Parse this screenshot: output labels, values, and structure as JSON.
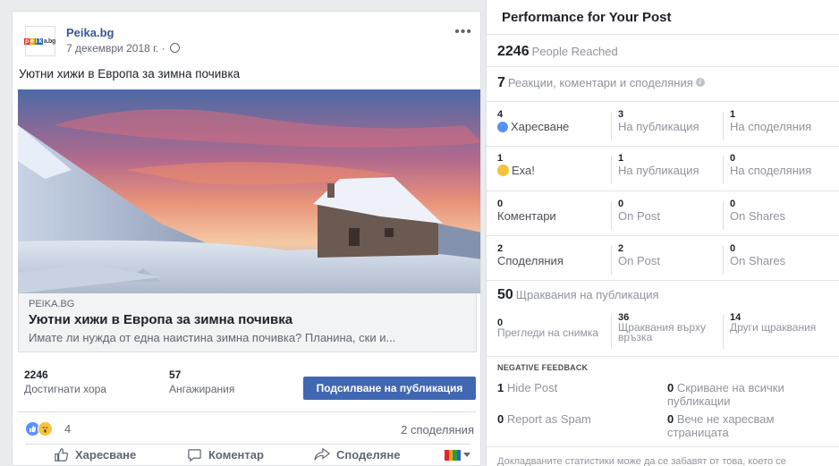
{
  "post": {
    "page_name": "Peika.bg",
    "logo_text": [
      "p",
      "e",
      "i",
      "k",
      "a.bg"
    ],
    "date": "7 декември 2018 г. ·",
    "menu_dots": "•••",
    "text": "Уютни хижи в Европа за зимна почивка",
    "link": {
      "domain": "PEIKA.BG",
      "title": "Уютни хижи в Европа за зимна почивка",
      "description": "Имате ли нужда от една наистина зимна почивка? Планина, ски и..."
    },
    "metrics": [
      {
        "value": "2246",
        "label": "Достигнати хора"
      },
      {
        "value": "57",
        "label": "Ангажирания"
      }
    ],
    "boost_label": "Подсилване на публикация",
    "reaction_count": "4",
    "shares_text": "2 споделяния",
    "actions": {
      "like": "Харесване",
      "comment": "Коментар",
      "share": "Споделяне"
    },
    "icons": [
      "globe-icon",
      "like-reaction-icon",
      "wow-reaction-icon",
      "thumbs-up-icon",
      "comment-icon",
      "share-icon",
      "chevron-down-icon"
    ]
  },
  "perf": {
    "title": "Performance for Your Post",
    "reached_value": "2246",
    "reached_label": "People Reached",
    "engagement_value": "7",
    "engagement_label": "Реакции, коментари и споделяния",
    "info_glyph": "i",
    "rows": [
      {
        "c1": {
          "n": "4",
          "t": "Харесване",
          "icon": "like"
        },
        "c2": {
          "n": "3",
          "t": "На публикация"
        },
        "c3": {
          "n": "1",
          "t": "На споделяния"
        }
      },
      {
        "c1": {
          "n": "1",
          "t": "Еха!",
          "icon": "wow"
        },
        "c2": {
          "n": "1",
          "t": "На публикация"
        },
        "c3": {
          "n": "0",
          "t": "На споделяния"
        }
      },
      {
        "c1": {
          "n": "0",
          "t": "Коментари"
        },
        "c2": {
          "n": "0",
          "t": "On Post"
        },
        "c3": {
          "n": "0",
          "t": "On Shares"
        }
      },
      {
        "c1": {
          "n": "2",
          "t": "Споделяния"
        },
        "c2": {
          "n": "2",
          "t": "On Post"
        },
        "c3": {
          "n": "0",
          "t": "On Shares"
        }
      }
    ],
    "clicks_value": "50",
    "clicks_label": "Щраквания на публикация",
    "clicks": [
      {
        "n": "0",
        "t": "Прегледи на снимка"
      },
      {
        "n": "36",
        "t": "Щраквания върху връзка"
      },
      {
        "n": "14",
        "t": "Други щраквания"
      }
    ],
    "negative_header": "NEGATIVE FEEDBACK",
    "negative": [
      {
        "n": "1",
        "t": "Hide Post"
      },
      {
        "n": "0",
        "t": "Скриване на всички публикации"
      },
      {
        "n": "0",
        "t": "Report as Spam"
      },
      {
        "n": "0",
        "t": "Вече не харесвам страницата"
      }
    ],
    "footer": "Докладваните статистики може да се забавят от това, което се"
  }
}
